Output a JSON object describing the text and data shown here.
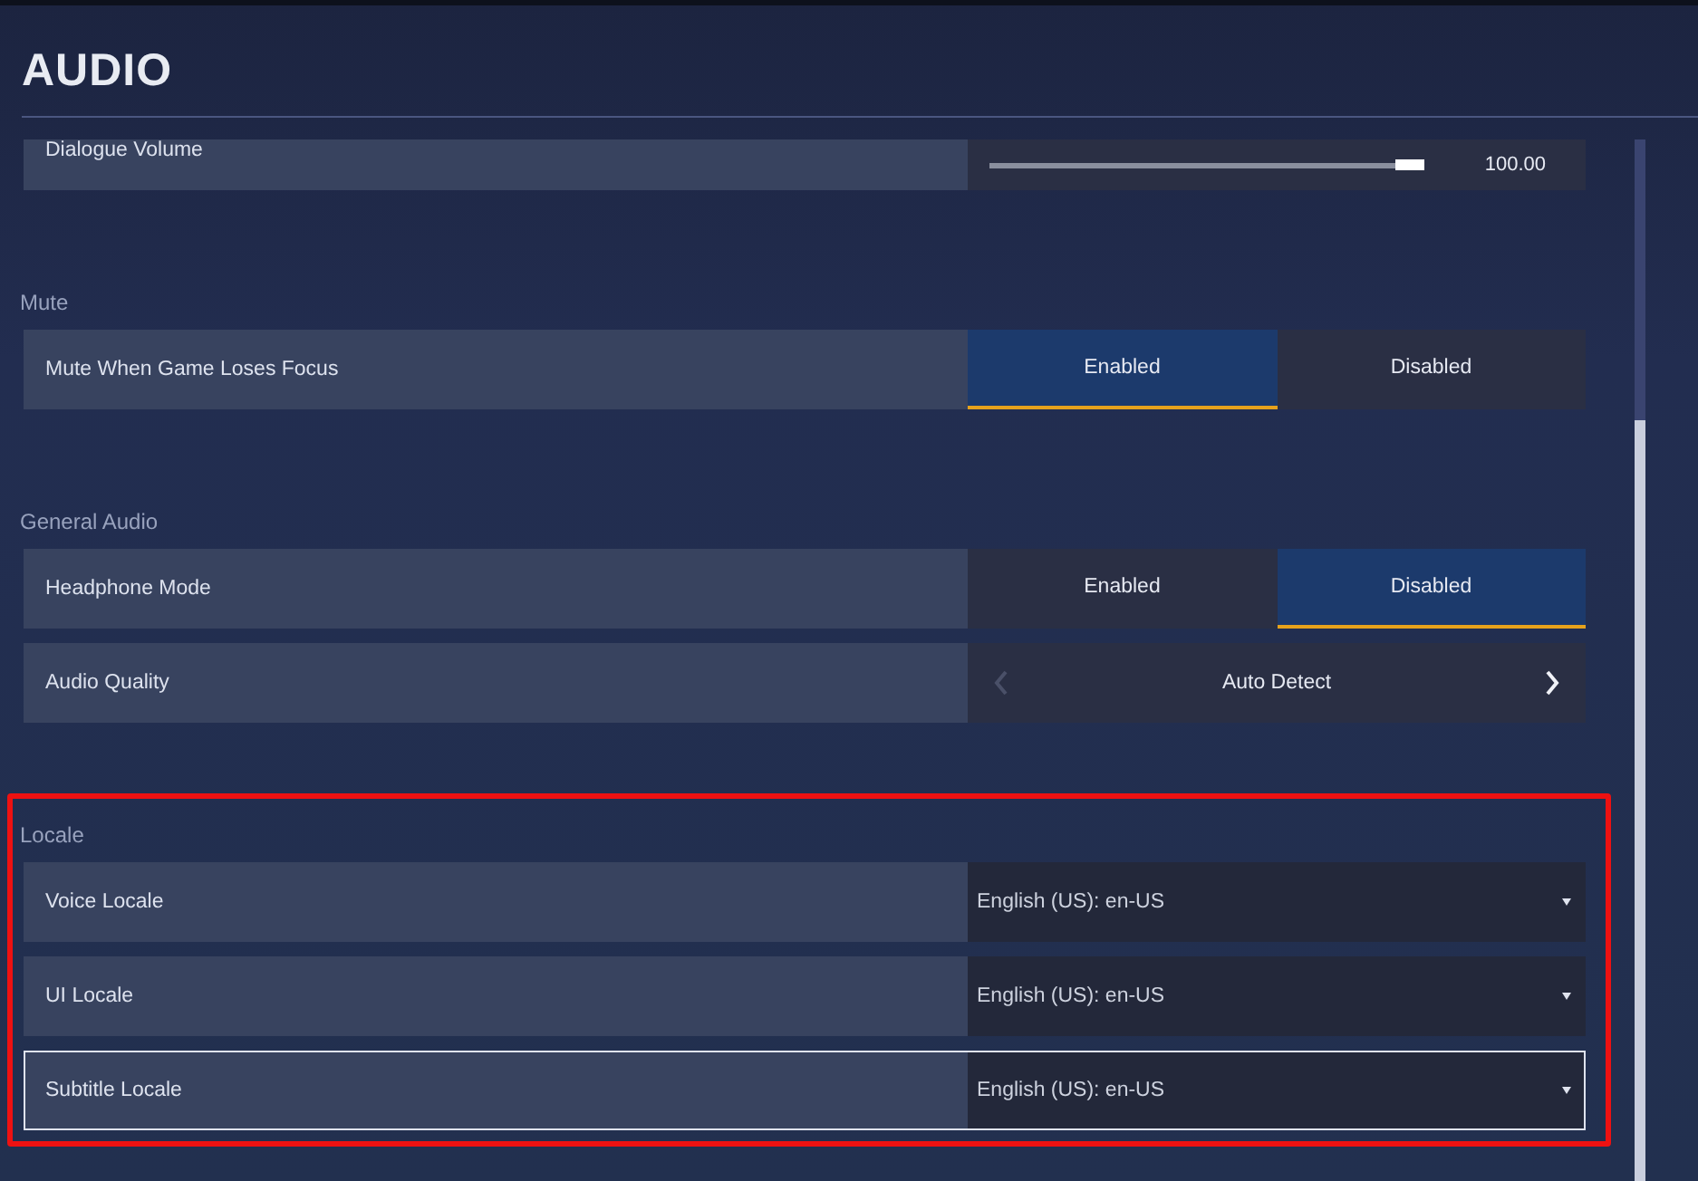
{
  "title": "AUDIO",
  "sections": [
    {
      "rows": [
        {
          "kind": "slider",
          "label": "Dialogue Volume",
          "level": 1.0,
          "reading": "100.00",
          "focused": false
        }
      ]
    },
    {
      "heading": "Mute",
      "highlighted": false,
      "rows": [
        {
          "kind": "toggle",
          "label": "Mute When Game Loses Focus",
          "focused": false,
          "options": [
            {
              "label": "Enabled",
              "selected": true
            },
            {
              "label": "Disabled",
              "selected": false
            }
          ]
        }
      ]
    },
    {
      "heading": "General Audio",
      "highlighted": false,
      "rows": [
        {
          "kind": "toggle",
          "label": "Headphone Mode",
          "focused": false,
          "options": [
            {
              "label": "Enabled",
              "selected": false
            },
            {
              "label": "Disabled",
              "selected": true
            }
          ]
        },
        {
          "kind": "selector",
          "label": "Audio Quality",
          "value": "Auto Detect",
          "focused": false,
          "prev_disabled": true
        }
      ]
    },
    {
      "heading": "Locale",
      "highlighted": true,
      "rows": [
        {
          "kind": "dropdown",
          "label": "Voice Locale",
          "value": "English (US): en-US",
          "focused": false
        },
        {
          "kind": "dropdown",
          "label": "UI Locale",
          "value": "English (US): en-US",
          "focused": false
        },
        {
          "kind": "dropdown",
          "label": "Subtitle Locale",
          "value": "English (US): en-US",
          "focused": true
        }
      ]
    }
  ]
}
